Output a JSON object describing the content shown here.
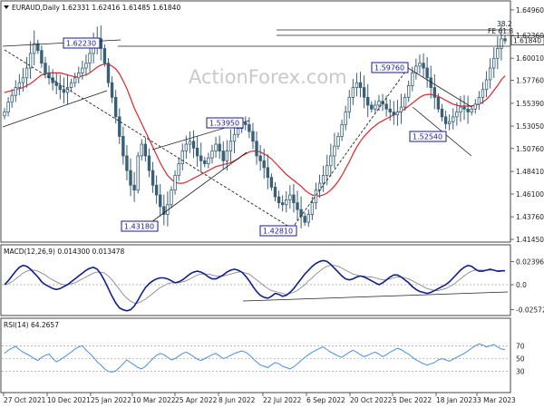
{
  "header": {
    "title": "EURAUD,Daily",
    "ohlc": "1.62331 1.62416 1.61485 1.61840"
  },
  "watermark": "ActionForex.com",
  "colors": {
    "candle": "#3a5f78",
    "ma": "#e0252a",
    "macd": "#0f1f8c",
    "signal": "#8a8a8a",
    "rsi": "#4a8fe0",
    "trendline": "#222222",
    "label": "#1a1a9a"
  },
  "chart_data": [
    {
      "type": "candlestick",
      "title": "EURAUD,Daily",
      "y_ticks": [
        "1.64960",
        "1.62360",
        "1.60010",
        "1.57760",
        "1.55390",
        "1.53050",
        "1.50760",
        "1.48410",
        "1.46100",
        "1.43760",
        "1.41450"
      ],
      "ylim": [
        1.4145,
        1.656
      ],
      "x_ticks": [
        "27 Oct 2021",
        "10 Dec 2021",
        "25 Jan 2022",
        "10 Mar 2022",
        "25 Apr 2022",
        "8 Jun 2022",
        "22 Jul 2022",
        "6 Sep 2022",
        "20 Oct 2022",
        "5 Dec 2022",
        "18 Jan 2023",
        "3 Mar 2023"
      ],
      "current_price": "1.61840",
      "annotations": [
        "1.62230",
        "1.53950",
        "1.43180",
        "1.42810",
        "1.59760",
        "1.52540",
        "38.2",
        "FE 61.8"
      ],
      "series": [
        {
          "name": "close",
          "values": [
            1.545,
            1.555,
            1.562,
            1.57,
            1.575,
            1.58,
            1.59,
            1.605,
            1.615,
            1.608,
            1.595,
            1.585,
            1.58,
            1.575,
            1.572,
            1.568,
            1.565,
            1.57,
            1.575,
            1.58,
            1.585,
            1.59,
            1.595,
            1.605,
            1.615,
            1.62,
            1.61,
            1.595,
            1.575,
            1.56,
            1.54,
            1.52,
            1.5,
            1.485,
            1.47,
            1.465,
            1.5,
            1.512,
            1.5,
            1.485,
            1.47,
            1.46,
            1.448,
            1.44,
            1.45,
            1.465,
            1.48,
            1.492,
            1.505,
            1.512,
            1.515,
            1.508,
            1.5,
            1.495,
            1.492,
            1.498,
            1.505,
            1.512,
            1.505,
            1.495,
            1.505,
            1.515,
            1.522,
            1.528,
            1.534,
            1.532,
            1.525,
            1.515,
            1.5,
            1.495,
            1.488,
            1.478,
            1.468,
            1.458,
            1.452,
            1.45,
            1.455,
            1.46,
            1.452,
            1.445,
            1.438,
            1.432,
            1.44,
            1.452,
            1.465,
            1.472,
            1.48,
            1.49,
            1.5,
            1.51,
            1.52,
            1.532,
            1.545,
            1.56,
            1.57,
            1.575,
            1.57,
            1.56,
            1.552,
            1.548,
            1.552,
            1.556,
            1.553,
            1.548,
            1.545,
            1.542,
            1.545,
            1.55,
            1.56,
            1.572,
            1.585,
            1.592,
            1.595,
            1.59,
            1.58,
            1.57,
            1.56,
            1.548,
            1.54,
            1.533,
            1.535,
            1.54,
            1.545,
            1.55,
            1.548,
            1.545,
            1.548,
            1.553,
            1.56,
            1.568,
            1.578,
            1.59,
            1.6,
            1.61,
            1.62,
            1.618
          ]
        },
        {
          "name": "MA",
          "values": [
            1.565,
            1.566,
            1.567,
            1.568,
            1.569,
            1.57,
            1.572,
            1.574,
            1.577,
            1.58,
            1.583,
            1.584,
            1.585,
            1.585,
            1.585,
            1.585,
            1.584,
            1.583,
            1.582,
            1.581,
            1.581,
            1.582,
            1.583,
            1.585,
            1.588,
            1.591,
            1.593,
            1.594,
            1.594,
            1.592,
            1.589,
            1.584,
            1.577,
            1.569,
            1.559,
            1.549,
            1.541,
            1.533,
            1.525,
            1.517,
            1.509,
            1.501,
            1.493,
            1.486,
            1.48,
            1.476,
            1.473,
            1.472,
            1.472,
            1.473,
            1.475,
            1.477,
            1.479,
            1.481,
            1.483,
            1.485,
            1.487,
            1.489,
            1.49,
            1.491,
            1.492,
            1.493,
            1.495,
            1.497,
            1.5,
            1.502,
            1.504,
            1.505,
            1.505,
            1.504,
            1.502,
            1.5,
            1.497,
            1.493,
            1.489,
            1.485,
            1.481,
            1.478,
            1.475,
            1.472,
            1.469,
            1.465,
            1.462,
            1.46,
            1.459,
            1.459,
            1.46,
            1.462,
            1.465,
            1.469,
            1.474,
            1.48,
            1.487,
            1.494,
            1.502,
            1.509,
            1.515,
            1.52,
            1.524,
            1.528,
            1.531,
            1.534,
            1.536,
            1.538,
            1.54,
            1.542,
            1.544,
            1.546,
            1.548,
            1.551,
            1.554,
            1.557,
            1.56,
            1.562,
            1.563,
            1.563,
            1.562,
            1.561,
            1.559,
            1.557,
            1.555,
            1.553,
            1.552,
            1.551,
            1.551,
            1.551,
            1.551,
            1.552,
            1.553,
            1.555,
            1.558,
            1.562,
            1.567,
            1.572,
            1.578,
            1.582
          ]
        }
      ]
    },
    {
      "type": "line",
      "title": "MACD(12,26,9) 0.014300 0.013478",
      "y_ticks": [
        "0.023963",
        "0.0",
        "-0.025726"
      ],
      "ylim": [
        -0.03,
        0.03
      ],
      "series": [
        {
          "name": "MACD",
          "values": [
            0.0,
            0.004,
            0.009,
            0.014,
            0.018,
            0.02,
            0.019,
            0.016,
            0.012,
            0.008,
            0.003,
            0.0,
            -0.002,
            -0.004,
            -0.005,
            -0.004,
            -0.002,
            0.0,
            0.003,
            0.006,
            0.009,
            0.012,
            0.015,
            0.017,
            0.018,
            0.016,
            0.011,
            0.004,
            -0.004,
            -0.012,
            -0.019,
            -0.024,
            -0.026,
            -0.027,
            -0.026,
            -0.022,
            -0.016,
            -0.009,
            -0.003,
            0.001,
            0.004,
            0.006,
            0.007,
            0.007,
            0.006,
            0.004,
            0.002,
            0.003,
            0.005,
            0.008,
            0.011,
            0.013,
            0.014,
            0.013,
            0.011,
            0.008,
            0.006,
            0.006,
            0.008,
            0.01,
            0.013,
            0.015,
            0.016,
            0.015,
            0.013,
            0.009,
            0.004,
            -0.002,
            -0.007,
            -0.011,
            -0.013,
            -0.014,
            -0.012,
            -0.009,
            -0.01,
            -0.012,
            -0.011,
            -0.008,
            -0.004,
            0.001,
            0.006,
            0.011,
            0.015,
            0.019,
            0.022,
            0.024,
            0.025,
            0.024,
            0.021,
            0.017,
            0.013,
            0.009,
            0.006,
            0.005,
            0.006,
            0.008,
            0.009,
            0.008,
            0.006,
            0.004,
            0.002,
            0.0,
            0.002,
            0.005,
            0.008,
            0.01,
            0.01,
            0.008,
            0.005,
            0.002,
            -0.002,
            -0.005,
            -0.007,
            -0.008,
            -0.009,
            -0.008,
            -0.006,
            -0.004,
            -0.002,
            0.0,
            0.003,
            0.007,
            0.011,
            0.015,
            0.018,
            0.02,
            0.019,
            0.016,
            0.014,
            0.014,
            0.015,
            0.016,
            0.015,
            0.014,
            0.0143,
            0.0143
          ]
        },
        {
          "name": "Signal",
          "values": [
            0.0,
            0.001,
            0.003,
            0.006,
            0.009,
            0.012,
            0.014,
            0.015,
            0.015,
            0.014,
            0.012,
            0.01,
            0.007,
            0.005,
            0.003,
            0.001,
            0.0,
            0.0,
            0.001,
            0.002,
            0.004,
            0.006,
            0.008,
            0.01,
            0.012,
            0.013,
            0.013,
            0.012,
            0.009,
            0.005,
            0.0,
            -0.005,
            -0.01,
            -0.014,
            -0.017,
            -0.019,
            -0.019,
            -0.017,
            -0.015,
            -0.012,
            -0.009,
            -0.006,
            -0.003,
            -0.001,
            0.001,
            0.002,
            0.002,
            0.002,
            0.003,
            0.004,
            0.006,
            0.008,
            0.01,
            0.011,
            0.011,
            0.011,
            0.01,
            0.009,
            0.009,
            0.009,
            0.01,
            0.011,
            0.012,
            0.013,
            0.013,
            0.012,
            0.011,
            0.008,
            0.005,
            0.002,
            -0.001,
            -0.004,
            -0.006,
            -0.007,
            -0.008,
            -0.009,
            -0.01,
            -0.009,
            -0.008,
            -0.006,
            -0.003,
            0.0,
            0.004,
            0.007,
            0.011,
            0.014,
            0.017,
            0.019,
            0.02,
            0.02,
            0.019,
            0.017,
            0.015,
            0.013,
            0.011,
            0.01,
            0.009,
            0.009,
            0.008,
            0.008,
            0.007,
            0.006,
            0.005,
            0.005,
            0.006,
            0.007,
            0.008,
            0.008,
            0.007,
            0.006,
            0.004,
            0.002,
            0.0,
            -0.002,
            -0.004,
            -0.005,
            -0.006,
            -0.006,
            -0.005,
            -0.004,
            -0.002,
            0.0,
            0.003,
            0.006,
            0.009,
            0.012,
            0.014,
            0.015,
            0.015,
            0.015,
            0.015,
            0.015,
            0.015,
            0.0135,
            0.0135
          ]
        }
      ]
    },
    {
      "type": "line",
      "title": "RSI(14) 64.2657",
      "y_ticks": [
        "70",
        "50",
        "30"
      ],
      "ylim": [
        0,
        100
      ],
      "series": [
        {
          "name": "RSI",
          "values": [
            58,
            63,
            66,
            69,
            64,
            60,
            57,
            54,
            50,
            47,
            52,
            55,
            57,
            50,
            45,
            48,
            52,
            56,
            60,
            65,
            68,
            70,
            63,
            58,
            52,
            45,
            40,
            34,
            30,
            29,
            31,
            36,
            42,
            48,
            44,
            40,
            36,
            34,
            38,
            44,
            50,
            55,
            58,
            56,
            52,
            48,
            50,
            54,
            58,
            60,
            57,
            53,
            49,
            47,
            50,
            53,
            56,
            58,
            54,
            50,
            52,
            55,
            58,
            60,
            62,
            60,
            56,
            50,
            45,
            40,
            38,
            36,
            40,
            44,
            42,
            38,
            36,
            34,
            37,
            42,
            47,
            52,
            56,
            60,
            63,
            66,
            68,
            64,
            60,
            57,
            54,
            52,
            56,
            60,
            63,
            60,
            56,
            53,
            55,
            58,
            60,
            57,
            53,
            56,
            60,
            63,
            66,
            64,
            60,
            57,
            52,
            48,
            45,
            42,
            40,
            42,
            44,
            48,
            50,
            48,
            46,
            49,
            52,
            55,
            58,
            62,
            66,
            70,
            73,
            71,
            68,
            70,
            72,
            68,
            65,
            64
          ]
        }
      ]
    }
  ]
}
